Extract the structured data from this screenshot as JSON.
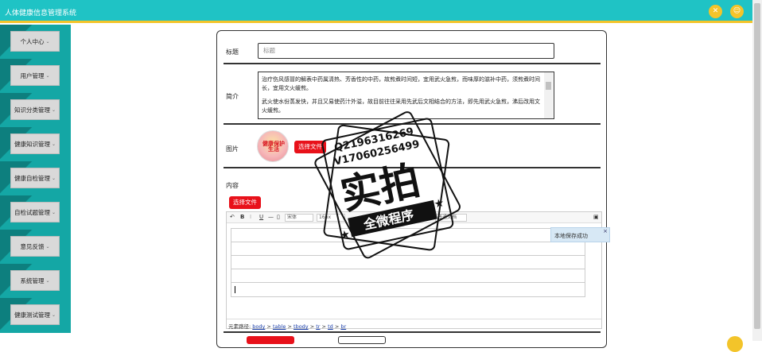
{
  "header": {
    "title": "人体健康信息管理系统",
    "icons": [
      "close-icon",
      "user-icon"
    ]
  },
  "sidebar": {
    "items": [
      {
        "label": "个人中心"
      },
      {
        "label": "用户管理"
      },
      {
        "label": "知识分类管理"
      },
      {
        "label": "健康知识管理"
      },
      {
        "label": "健康自检管理"
      },
      {
        "label": "自检试题管理"
      },
      {
        "label": "意见反馈"
      },
      {
        "label": "系统管理"
      },
      {
        "label": "健康测试管理"
      }
    ]
  },
  "form": {
    "title_label": "标题",
    "title_placeholder": "标题",
    "intro_label": "简介",
    "intro_p1": "治疗伤风感冒的解表中药属清热、芳香性的中药，故煎煮时间短，宜用武火急煎，而味厚的滋补中药，须煎煮时间长，宜用文火缓煎。",
    "intro_p2": "武火使水份蒸发快，并且又易使药汁外溢，故目前往往采用先武后文相结合的方法，即先用武火急煎，沸后改用文火缓煎。",
    "image_label": "图片",
    "image_text": "健康保护生活",
    "select_file": "选择文件",
    "content_label": "内容",
    "content_select_file": "选择文件"
  },
  "editor": {
    "font_family": "宋体",
    "font_size": "16px",
    "style_option": "普通文档",
    "toast": "本地保存成功",
    "path_label": "元素路径:",
    "path": [
      "body",
      "table",
      "tbody",
      "tr",
      "td",
      "br"
    ]
  },
  "watermark": {
    "line1": "Q2196316269",
    "line2": "V17060256499",
    "big": "实拍",
    "banner": "全微程序"
  }
}
